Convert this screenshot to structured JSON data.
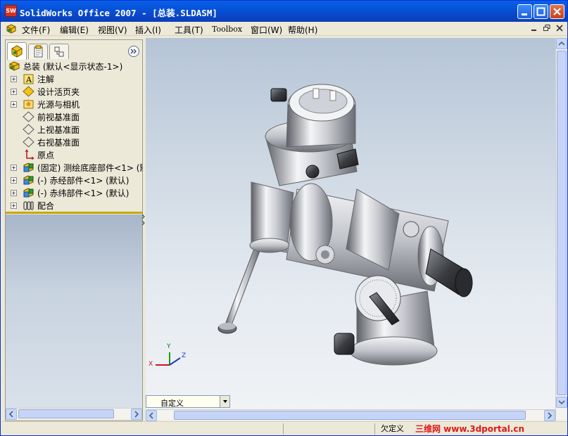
{
  "window": {
    "title": "SolidWorks Office 2007 - [总装.SLDASM]",
    "app_icon_text": "SW"
  },
  "menubar": {
    "items": [
      {
        "label": "文件(F)"
      },
      {
        "label": "编辑(E)"
      },
      {
        "label": "视图(V)"
      },
      {
        "label": "插入(I)"
      },
      {
        "label": "工具(T)"
      },
      {
        "label": "Toolbox"
      },
      {
        "label": "窗口(W)"
      },
      {
        "label": "帮助(H)"
      }
    ]
  },
  "feature_tree": {
    "root": "总装  (默认<显示状态-1>)",
    "items": [
      {
        "label": "注解",
        "expandable": true,
        "icon": "annotation-icon"
      },
      {
        "label": "设计活页夹",
        "expandable": true,
        "icon": "design-binder-icon"
      },
      {
        "label": "光源与相机",
        "expandable": true,
        "icon": "lights-cameras-icon"
      },
      {
        "label": "前视基准面",
        "expandable": false,
        "icon": "plane-icon"
      },
      {
        "label": "上视基准面",
        "expandable": false,
        "icon": "plane-icon"
      },
      {
        "label": "右视基准面",
        "expandable": false,
        "icon": "plane-icon"
      },
      {
        "label": "原点",
        "expandable": false,
        "icon": "origin-icon"
      },
      {
        "label": "(固定) 测绘底座部件<1> (默",
        "expandable": true,
        "icon": "subassembly-icon"
      },
      {
        "label": "(-) 赤经部件<1> (默认)",
        "expandable": true,
        "icon": "subassembly-icon"
      },
      {
        "label": "(-) 赤纬部件<1> (默认)",
        "expandable": true,
        "icon": "subassembly-icon"
      },
      {
        "label": "配合",
        "expandable": true,
        "icon": "mates-icon"
      }
    ]
  },
  "viewport": {
    "view_orientation": "自定义",
    "triad": {
      "x": "X",
      "y": "Y",
      "z": "Z"
    }
  },
  "statusbar": {
    "status": "欠定义",
    "watermark": "三维网 www.3dportal.cn"
  },
  "colors": {
    "title_bar": "#0a5fe8",
    "accent_yellow": "#c8a800",
    "watermark": "#e01818"
  }
}
